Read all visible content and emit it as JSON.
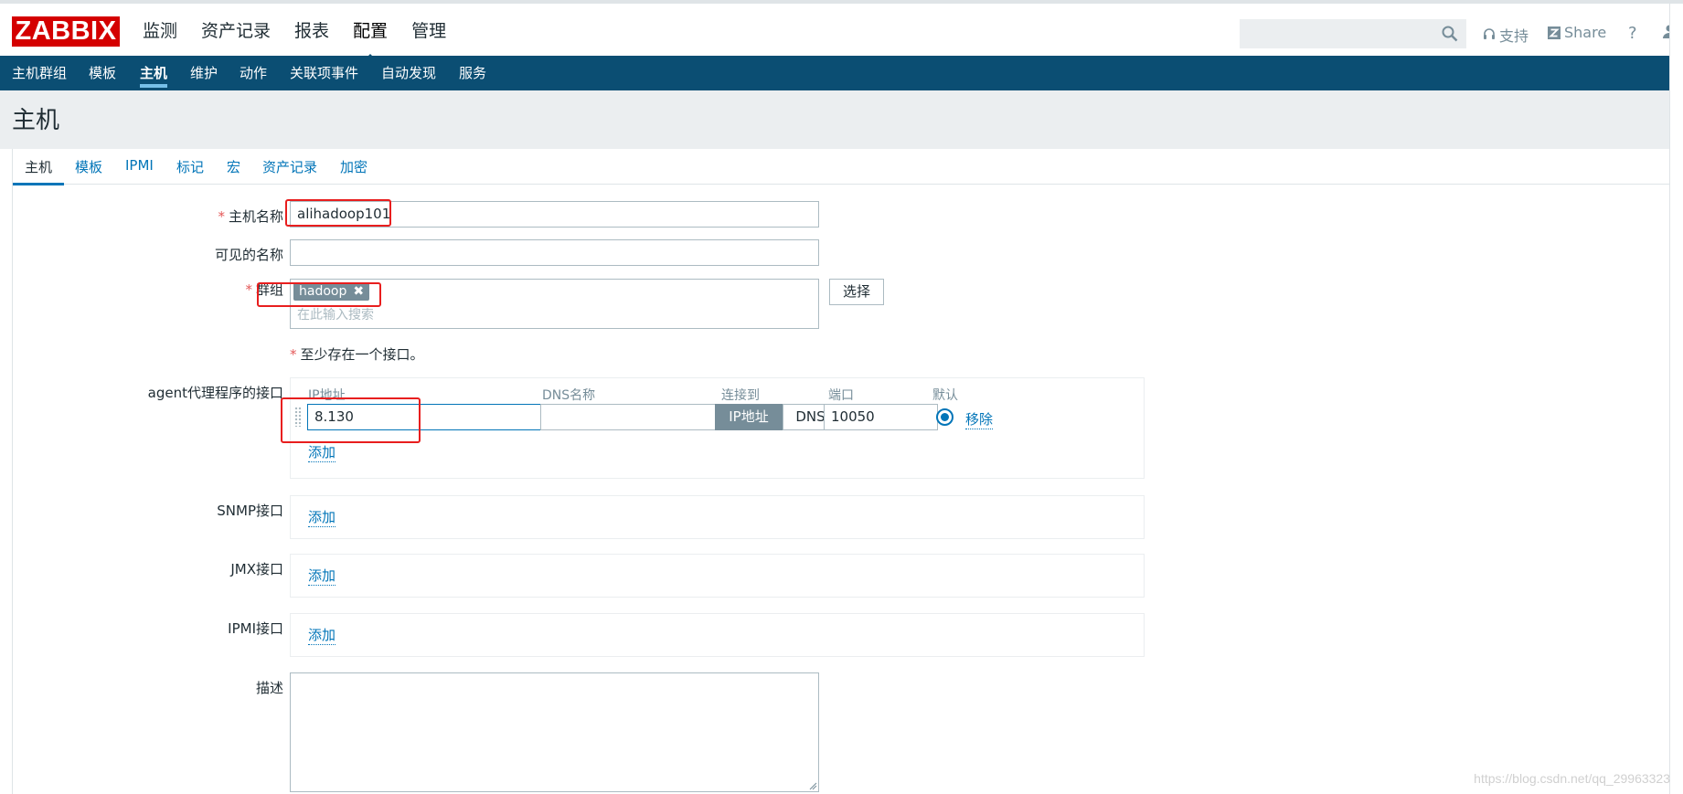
{
  "header": {
    "logo": "ZABBIX",
    "main_nav": [
      "监测",
      "资产记录",
      "报表",
      "配置",
      "管理"
    ],
    "active_main_nav": "配置",
    "search": {
      "value": "",
      "placeholder": ""
    },
    "support_label": "支持",
    "share_label": "Share",
    "help_label": "?"
  },
  "subnav": {
    "items": [
      "主机群组",
      "模板",
      "主机",
      "维护",
      "动作",
      "关联项事件",
      "自动发现",
      "服务"
    ],
    "active": "主机"
  },
  "page": {
    "title": "主机"
  },
  "tabs": {
    "items": [
      "主机",
      "模板",
      "IPMI",
      "标记",
      "宏",
      "资产记录",
      "加密"
    ],
    "active": "主机"
  },
  "form": {
    "host_name": {
      "label": "主机名称",
      "required": true,
      "value": "alihadoop101"
    },
    "visible_name": {
      "label": "可见的名称",
      "value": ""
    },
    "groups": {
      "label": "群组",
      "required": true,
      "tags": [
        "hadoop"
      ],
      "search_placeholder": "在此输入搜索",
      "select_button": "选择"
    },
    "interface_notice": "至少存在一个接口。",
    "agent_interface": {
      "label": "agent代理程序的接口",
      "columns": [
        "IP地址",
        "DNS名称",
        "连接到",
        "端口",
        "默认"
      ],
      "ip": "8.130",
      "dns": "",
      "connect_options": [
        "IP地址",
        "DNS"
      ],
      "connect_selected": "IP地址",
      "port": "10050",
      "remove_label": "移除",
      "add_label": "添加"
    },
    "snmp_interface": {
      "label": "SNMP接口",
      "add_label": "添加"
    },
    "jmx_interface": {
      "label": "JMX接口",
      "add_label": "添加"
    },
    "ipmi_interface": {
      "label": "IPMI接口",
      "add_label": "添加"
    },
    "description": {
      "label": "描述",
      "value": ""
    }
  },
  "watermark": "https://blog.csdn.net/qq_29963323",
  "colors": {
    "logo_red": "#d40000",
    "subnav_bg": "#0b4e73",
    "link_blue": "#0275b8",
    "annotation_red": "#e81e1e"
  }
}
